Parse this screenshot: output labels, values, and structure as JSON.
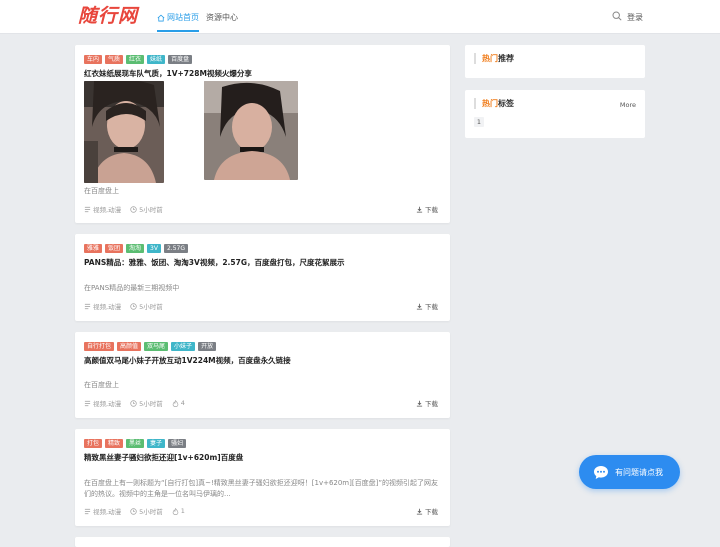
{
  "header": {
    "logo": "随行网",
    "nav": [
      {
        "label": "网站首页",
        "active": true
      },
      {
        "label": "资源中心",
        "active": false
      }
    ],
    "login": "登录"
  },
  "posts": [
    {
      "tags": [
        {
          "text": "车内",
          "color": "#e8735e"
        },
        {
          "text": "气质",
          "color": "#e8735e"
        },
        {
          "text": "红衣",
          "color": "#5bbd72"
        },
        {
          "text": "妹纸",
          "color": "#3fb6c9"
        },
        {
          "text": "百度盘",
          "color": "#7b7f85"
        }
      ],
      "title": "红衣妹纸展现车队气质，1V+728M视频火爆分享",
      "excerpt": "在百度盘上",
      "category": "视频,动漫",
      "time": "5小时前",
      "download": "下载"
    },
    {
      "tags": [
        {
          "text": "雅雅",
          "color": "#e8735e"
        },
        {
          "text": "饭团",
          "color": "#e8735e"
        },
        {
          "text": "淘淘",
          "color": "#5bbd72"
        },
        {
          "text": "3V",
          "color": "#3fb6c9"
        },
        {
          "text": "2.57G",
          "color": "#7b7f85"
        }
      ],
      "title": "PANS精品：雅雅、饭团、淘淘3V视频，2.57G，百度盘打包，尺度花絮展示",
      "excerpt": "在PANS精品的最新三期视频中",
      "category": "视频,动漫",
      "time": "5小时前",
      "download": "下载"
    },
    {
      "tags": [
        {
          "text": "自行打包",
          "color": "#e8735e"
        },
        {
          "text": "高颜值",
          "color": "#e8735e"
        },
        {
          "text": "双马尾",
          "color": "#5bbd72"
        },
        {
          "text": "小妹子",
          "color": "#3fb6c9"
        },
        {
          "text": "开放",
          "color": "#7b7f85"
        }
      ],
      "title": "高颜值双马尾小妹子开放互动1V224M视频，百度盘永久链接",
      "excerpt": "在百度盘上",
      "category": "视频,动漫",
      "time": "5小时前",
      "likes": "4",
      "download": "下载"
    },
    {
      "tags": [
        {
          "text": "打包",
          "color": "#e8735e"
        },
        {
          "text": "精致",
          "color": "#e8735e"
        },
        {
          "text": "黑丝",
          "color": "#5bbd72"
        },
        {
          "text": "妻子",
          "color": "#3fb6c9"
        },
        {
          "text": "骚妇",
          "color": "#7b7f85"
        }
      ],
      "title": "精致黑丝妻子骚妇欲拒还迎[1v+620m]百度盘",
      "excerpt": "在百度盘上有一则标题为“[自行打包]真~!精致黑丝妻子骚妇欲拒还迎呀！[1v+620m][百度盘]”的视频引起了网友们的热议。视频中的主角是一位名叫马伊璃的...",
      "category": "视频,动漫",
      "time": "5小时前",
      "likes": "1",
      "download": "下载"
    }
  ],
  "sidebar": {
    "hot_recommend": {
      "hot": "热门",
      "rest": "推荐"
    },
    "hot_tags": {
      "hot": "热门",
      "rest": "标签",
      "more": "More",
      "chips": [
        "1"
      ]
    }
  },
  "chat": {
    "label": "有问题请点我"
  }
}
